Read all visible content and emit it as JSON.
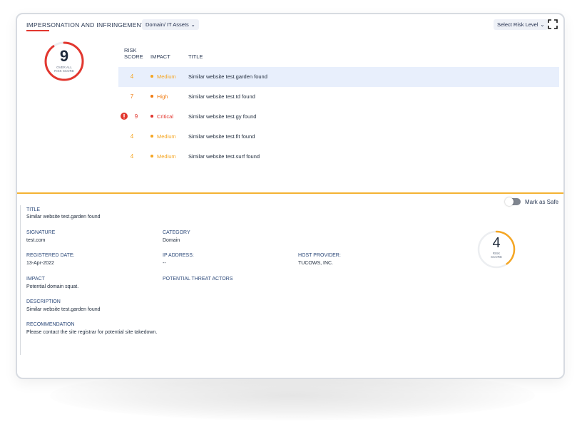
{
  "header": {
    "title": "IMPERSONATION AND INFRINGEMENT",
    "assets_dropdown": "Domain/ IT Assets",
    "risk_dropdown": "Select Risk Level"
  },
  "overall_score": {
    "value": "9",
    "label_line1": "OVER ALL",
    "label_line2": "RISK SCORE",
    "fraction": 0.9
  },
  "table": {
    "headers": {
      "risk_line1": "RISK",
      "risk_line2": "SCORE",
      "impact": "IMPACT",
      "title": "TITLE"
    },
    "rows": [
      {
        "score": "4",
        "impact": "Medium",
        "title": "Similar website test.garden found",
        "color": "#f5a623",
        "selected": true,
        "alert": false
      },
      {
        "score": "7",
        "impact": "High",
        "title": "Similar website test.td found",
        "color": "#f07c12",
        "selected": false,
        "alert": false
      },
      {
        "score": "9",
        "impact": "Critical",
        "title": "Similar website test.gy found",
        "color": "#e2372f",
        "selected": false,
        "alert": true
      },
      {
        "score": "4",
        "impact": "Medium",
        "title": "Similar website test.fit found",
        "color": "#f5a623",
        "selected": false,
        "alert": false
      },
      {
        "score": "4",
        "impact": "Medium",
        "title": "Similar website test.surf found",
        "color": "#f5a623",
        "selected": false,
        "alert": false
      }
    ]
  },
  "detail": {
    "mark_safe": "Mark as Safe",
    "title_label": "TITLE",
    "title_value": "Similar website test.garden found",
    "signature_label": "SIGNATURE",
    "signature_value": "test.com",
    "category_label": "CATEGORY",
    "category_value": "Domain",
    "registered_label": "REGISTERED DATE:",
    "registered_value": "13-Apr-2022",
    "ip_label": "IP ADDRESS:",
    "ip_value": "--",
    "host_label": "HOST PROVIDER:",
    "host_value": "TUCOWS, INC.",
    "impact_label": "IMPACT",
    "impact_value": "Potential domain squat.",
    "threat_label": "POTENTIAL THREAT ACTORS",
    "description_label": "DESCRIPTION",
    "description_value": "Similar website test.garden found",
    "recommendation_label": "RECOMMENDATION",
    "recommendation_value": "Please contact the site registrar for potential site takedown.",
    "score": {
      "value": "4",
      "label_line1": "RISK",
      "label_line2": "SCORE",
      "fraction": 0.4
    }
  },
  "colors": {
    "accent_red": "#e2372f",
    "accent_orange": "#f5a623",
    "divider": "#f4b233",
    "selected_row": "#e8effc"
  }
}
